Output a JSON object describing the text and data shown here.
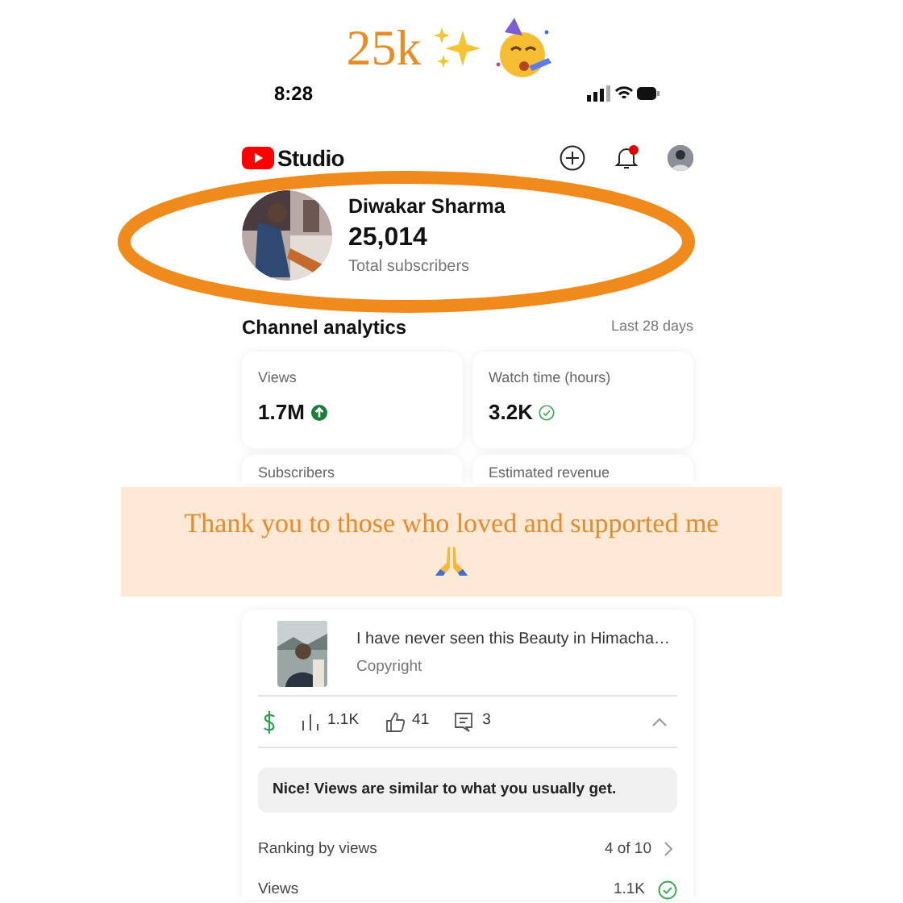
{
  "overlay": {
    "headline": "25k",
    "banner": "Thank you to those who loved and supported me"
  },
  "status_bar": {
    "time": "8:28"
  },
  "header": {
    "logo_text": "Studio",
    "notification_dot": true
  },
  "channel": {
    "name": "Diwakar Sharma",
    "subscribers": "25,014",
    "subscribers_label": "Total subscribers"
  },
  "analytics": {
    "title": "Channel analytics",
    "period": "Last 28 days",
    "cards": [
      {
        "label": "Views",
        "value": "1.7M",
        "kind": "up"
      },
      {
        "label": "Watch time (hours)",
        "value": "3.2K",
        "kind": "check"
      },
      {
        "label": "Subscribers"
      },
      {
        "label": "Estimated revenue"
      }
    ]
  },
  "video": {
    "title": "I have never seen this Beauty in Himacha…",
    "subtitle": "Copyright",
    "expanded": true,
    "stats": [
      {
        "kind": "views",
        "value": "1.1K"
      },
      {
        "kind": "likes",
        "value": "41"
      },
      {
        "kind": "comments",
        "value": "3"
      }
    ],
    "message": "Nice! Views are similar to what you usually get.",
    "rows": [
      {
        "label": "Ranking by views",
        "value": "4 of 10",
        "kind": "link"
      },
      {
        "label": "Views",
        "value": "1.1K",
        "kind": "check"
      }
    ]
  }
}
